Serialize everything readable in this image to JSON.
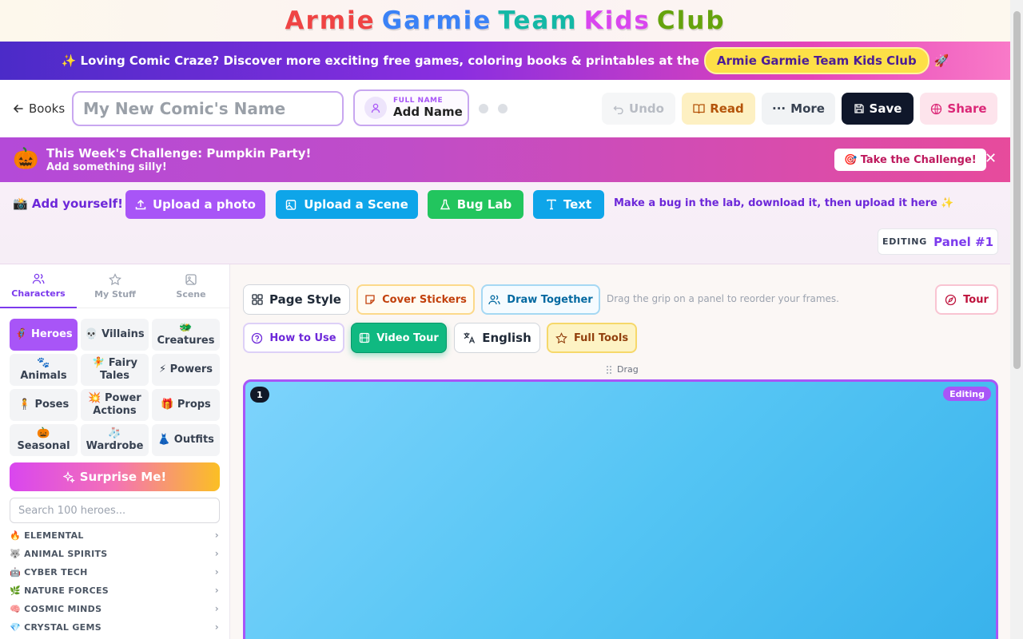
{
  "header": {
    "title_words": [
      {
        "text": "Armie",
        "color": "#ef4444"
      },
      {
        "text": "Garmie",
        "color": "#3b82f6"
      },
      {
        "text": "Team",
        "color": "#14b8a6"
      },
      {
        "text": "Kids",
        "color": "#d946ef"
      },
      {
        "text": "Club",
        "color": "#65a30d"
      }
    ]
  },
  "promo": {
    "text": "✨ Loving Comic Craze? Discover more exciting free games, coloring books & printables at the",
    "link_label": "Armie Garmie Team Kids Club",
    "trailing_emoji": "🚀"
  },
  "toolbar": {
    "back_label": "Books",
    "comic_name_placeholder": "My New Comic's Name",
    "full_name_label": "FULL NAME",
    "full_name_value": "Add Name",
    "undo_label": "Undo",
    "read_label": "Read",
    "more_label": "More",
    "save_label": "Save",
    "share_label": "Share"
  },
  "challenge": {
    "emoji": "🎃",
    "title": "This Week's Challenge: Pumpkin Party!",
    "subtitle": "Add something silly!",
    "cta_label": "🎯 Take the Challenge!",
    "close_icon": "close-icon"
  },
  "add_bar": {
    "lead": "📸 Add yourself!",
    "upload_photo_label": "Upload a photo",
    "upload_scene_label": "Upload a Scene",
    "bug_lab_label": "Bug Lab",
    "text_label": "Text",
    "hint": "Make a bug in the lab, download it, then upload it here ✨",
    "editing_key": "EDITING",
    "editing_value": "Panel #1"
  },
  "sidebar": {
    "tabs": [
      {
        "label": "Characters",
        "icon": "users-icon",
        "active": true
      },
      {
        "label": "My Stuff",
        "icon": "star-icon",
        "active": false
      },
      {
        "label": "Scene",
        "icon": "image-icon",
        "active": false
      }
    ],
    "categories": [
      {
        "label": "🦸 Heroes",
        "active": true
      },
      {
        "label": "💀 Villains",
        "active": false
      },
      {
        "label": "🐲\nCreatures",
        "active": false
      },
      {
        "label": "🐾\nAnimals",
        "active": false
      },
      {
        "label": "🧚 Fairy\nTales",
        "active": false
      },
      {
        "label": "⚡ Powers",
        "active": false
      },
      {
        "label": "🧍 Poses",
        "active": false
      },
      {
        "label": "💥 Power\nActions",
        "active": false
      },
      {
        "label": "🎁 Props",
        "active": false
      },
      {
        "label": "🎃\nSeasonal",
        "active": false
      },
      {
        "label": "🧦\nWardrobe",
        "active": false
      },
      {
        "label": "👗 Outfits",
        "active": false
      }
    ],
    "surprise_label": "Surprise Me!",
    "search_placeholder": "Search 100 heroes...",
    "groups": [
      "🔥 ELEMENTAL",
      "🐺 ANIMAL SPIRITS",
      "🤖 CYBER TECH",
      "🌿 NATURE FORCES",
      "🧠 COSMIC MINDS",
      "💎 CRYSTAL GEMS"
    ]
  },
  "main": {
    "page_style_label": "Page Style",
    "cover_stickers_label": "Cover Stickers",
    "draw_together_label": "Draw Together",
    "reorder_hint": "Drag the grip on a panel to reorder your frames.",
    "tour_label": "Tour",
    "how_to_use_label": "How to Use",
    "video_tour_label": "Video Tour",
    "language_label": "English",
    "full_tools_label": "Full Tools",
    "drag_label": "Drag",
    "panel_number": "1",
    "panel_badge": "Editing"
  }
}
